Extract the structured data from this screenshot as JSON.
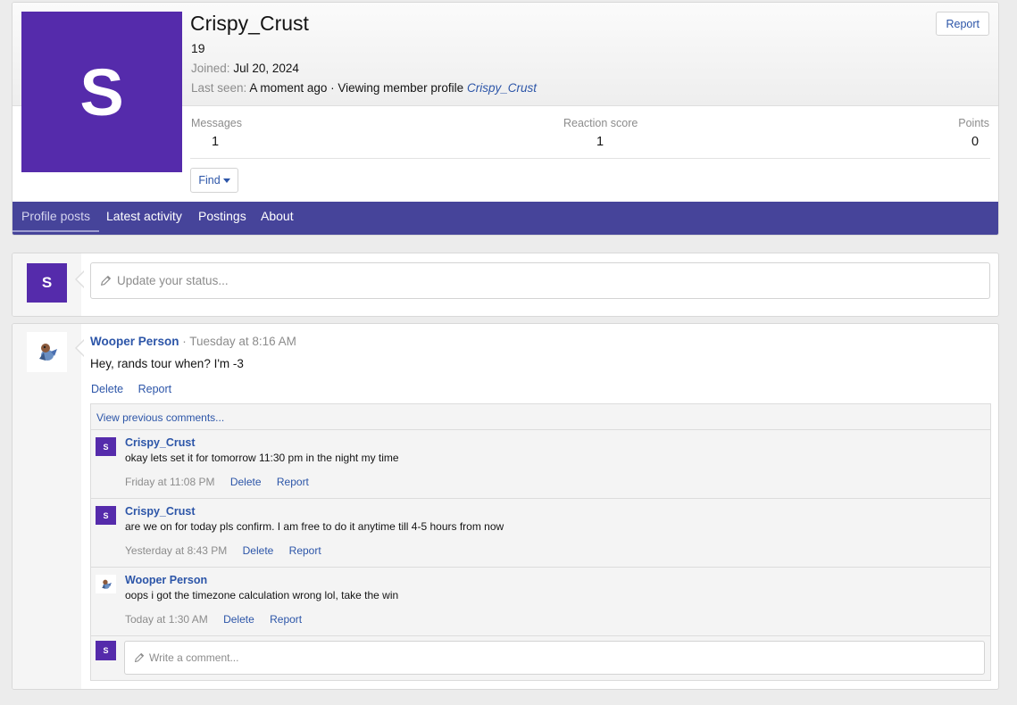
{
  "profile": {
    "avatar_letter": "S",
    "username": "Crispy_Crust",
    "user_title": "19",
    "joined_label": "Joined:",
    "joined_value": "Jul 20, 2024",
    "last_seen_label": "Last seen:",
    "last_seen_value": "A moment ago · Viewing member profile",
    "last_seen_link": "Crispy_Crust",
    "report_label": "Report",
    "find_label": "Find",
    "colors": {
      "avatar_bg": "#552bab",
      "tabbar_bg": "#46449a",
      "link": "#2c55a8"
    }
  },
  "stats": {
    "messages_label": "Messages",
    "messages_value": "1",
    "reaction_label": "Reaction score",
    "reaction_value": "1",
    "points_label": "Points",
    "points_value": "0"
  },
  "tabs": [
    {
      "label": "Profile posts",
      "active": true
    },
    {
      "label": "Latest activity",
      "active": false
    },
    {
      "label": "Postings",
      "active": false
    },
    {
      "label": "About",
      "active": false
    }
  ],
  "status": {
    "avatar_letter": "S",
    "placeholder": "Update your status..."
  },
  "post": {
    "author": "Wooper Person",
    "time": "· Tuesday at 8:16 AM",
    "message": "Hey, rands tour when? I'm -3",
    "delete_label": "Delete",
    "report_label": "Report",
    "avatar_icon": "wooper-avatar-icon"
  },
  "comments": {
    "view_previous": "View previous comments...",
    "items": [
      {
        "author": "Crispy_Crust",
        "avatar_letter": "S",
        "text": "okay lets set it for tomorrow 11:30 pm in the night my time",
        "time": "Friday at 11:08 PM",
        "delete_label": "Delete",
        "report_label": "Report"
      },
      {
        "author": "Crispy_Crust",
        "avatar_letter": "S",
        "text": "are we on for today pls confirm. I am free to do it anytime till 4-5 hours from now",
        "time": "Yesterday at 8:43 PM",
        "delete_label": "Delete",
        "report_label": "Report"
      },
      {
        "author": "Wooper Person",
        "avatar_letter": "",
        "text": "oops i got the timezone calculation wrong lol, take the win",
        "time": "Today at 1:30 AM",
        "delete_label": "Delete",
        "report_label": "Report"
      }
    ],
    "input_avatar_letter": "S",
    "input_placeholder": "Write a comment..."
  }
}
